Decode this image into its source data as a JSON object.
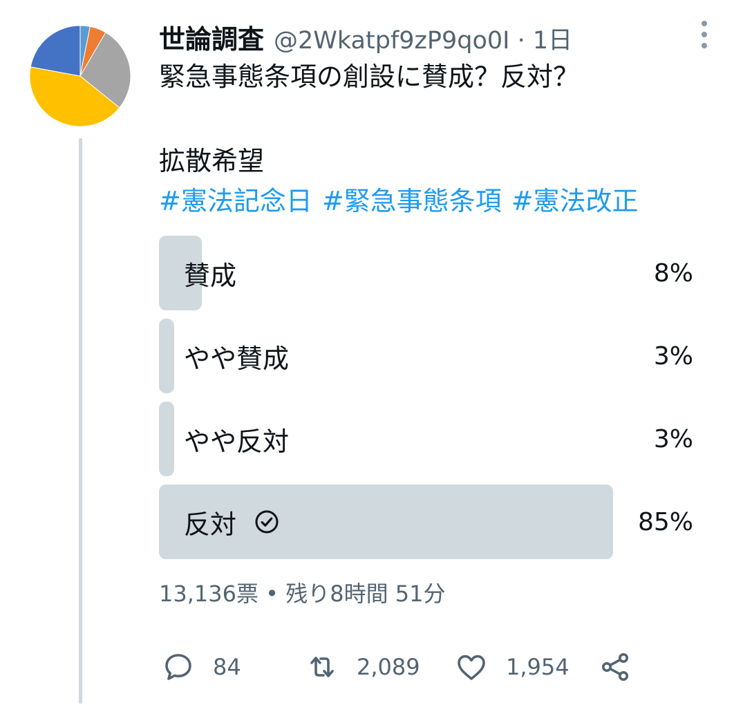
{
  "tweet": {
    "display_name": "世論調査",
    "handle": "@2Wkatpf9zP9qo0I",
    "separator": " · ",
    "time": "1日",
    "text_line1": "緊急事態条項の創設に賛成？反対？",
    "text_line2": "拡散希望",
    "hashtags": [
      "#憲法記念日",
      "#緊急事態条項",
      "#憲法改正"
    ]
  },
  "avatar": {
    "icon": "pie-chart-avatar",
    "slices": [
      {
        "color": "#5b9bd5",
        "value": 3
      },
      {
        "color": "#ed7d31",
        "value": 5
      },
      {
        "color": "#a5a5a5",
        "value": 26
      },
      {
        "color": "#ffc000",
        "value": 40
      },
      {
        "color": "#4472c4",
        "value": 21
      }
    ]
  },
  "poll": {
    "options": [
      {
        "label": "賛成",
        "percent": "8%",
        "fill": 0.08,
        "selected": false
      },
      {
        "label": "やや賛成",
        "percent": "3%",
        "fill": 0.03,
        "selected": false
      },
      {
        "label": "やや反対",
        "percent": "3%",
        "fill": 0.03,
        "selected": false
      },
      {
        "label": "反対",
        "percent": "85%",
        "fill": 0.85,
        "selected": true
      }
    ],
    "votes": "13,136票",
    "meta_separator": " • ",
    "time_left": "残り8時間 51分",
    "bar_color": "#cfd9de"
  },
  "actions": {
    "reply_count": "84",
    "retweet_count": "2,089",
    "like_count": "1,954",
    "icons": [
      "reply-icon",
      "retweet-icon",
      "like-icon",
      "share-icon"
    ]
  },
  "colors": {
    "hashtag": "#1d9bf0",
    "secondary_text": "#536471",
    "primary_text": "#0f1419"
  }
}
